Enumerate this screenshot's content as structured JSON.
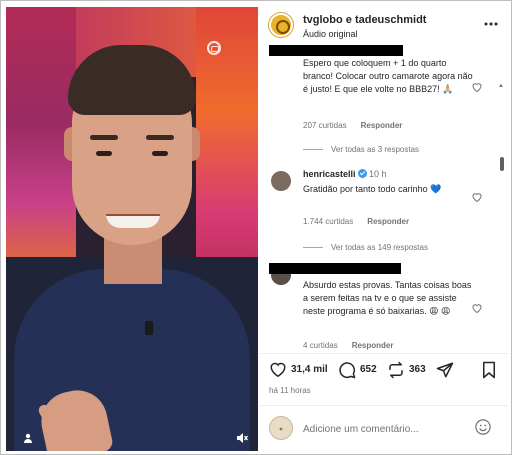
{
  "post": {
    "author_line": "tvglobo e tadeuschmidt",
    "audio": "Áudio original",
    "more_icon": "more-horizontal-icon"
  },
  "comments": [
    {
      "username_redacted": true,
      "text": "Espero que coloquem + 1 do quarto branco! Colocar outro camarote agora não é justo! E que ele volte no BBB27! 🙏🏼",
      "likes": "207 curtidas",
      "reply": "Responder",
      "view_replies": "Ver todas as 3 respostas"
    },
    {
      "username": "henricastelli",
      "verified": true,
      "time": "10 h",
      "text": "Gratidão por tanto todo carinho 💙",
      "likes": "1.744 curtidas",
      "reply": "Responder",
      "view_replies": "Ver todas as 149 respostas"
    },
    {
      "username_redacted": true,
      "text": "Absurdo estas provas. Tantas coisas boas a serem feitas na tv e o que se assiste neste programa é só baixarias. 😩 😩",
      "likes": "4 curtidas",
      "reply": "Responder"
    }
  ],
  "actions": {
    "likes": "31,4 mil",
    "comments": "652",
    "reposts": "363",
    "time_ago": "há 11 horas"
  },
  "add_comment": {
    "placeholder": "Adicione um comentário..."
  },
  "colors": {
    "text": "#262626",
    "secondary": "#737373",
    "verified": "#3897f0",
    "redaction": "#000000"
  }
}
